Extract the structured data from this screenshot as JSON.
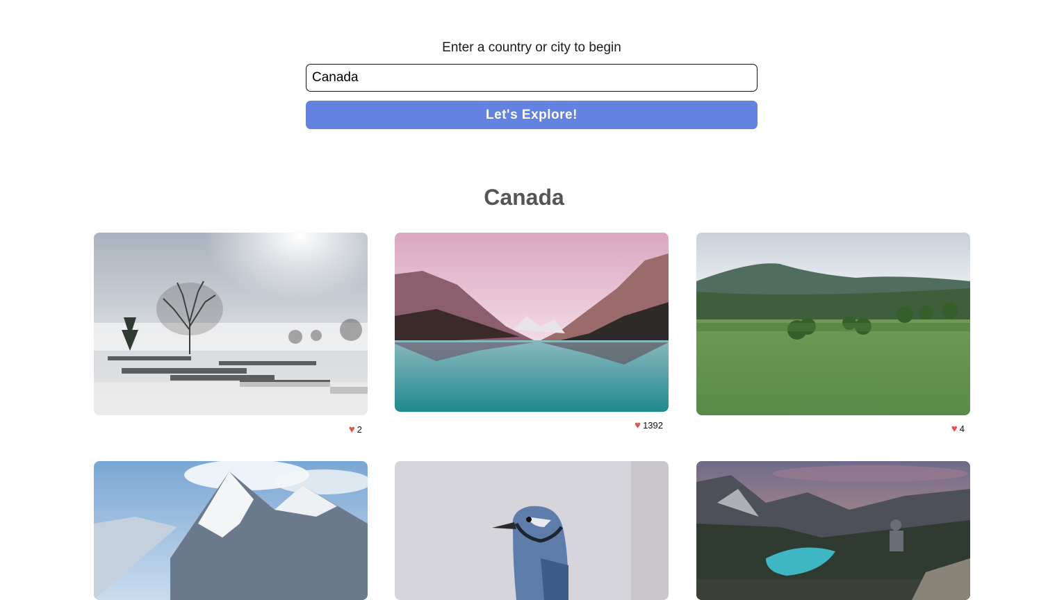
{
  "search": {
    "prompt": "Enter a country or city to begin",
    "value": "Canada",
    "button_label": "Let's Explore!"
  },
  "results": {
    "title": "Canada",
    "photos": [
      {
        "subject": "foggy lake docks with bare tree",
        "likes": "2"
      },
      {
        "subject": "turquoise mountain lake under pink sky",
        "likes": "1392"
      },
      {
        "subject": "green field with forested hills",
        "likes": "4"
      },
      {
        "subject": "snowy mountain peak",
        "likes": ""
      },
      {
        "subject": "blue jay bird",
        "likes": ""
      },
      {
        "subject": "hiker overlooking alpine lake at sunset",
        "likes": ""
      }
    ]
  },
  "colors": {
    "accent": "#6483e0",
    "heart": "#e4524c",
    "title": "#555555"
  },
  "icons": {
    "like": "heart-icon"
  }
}
